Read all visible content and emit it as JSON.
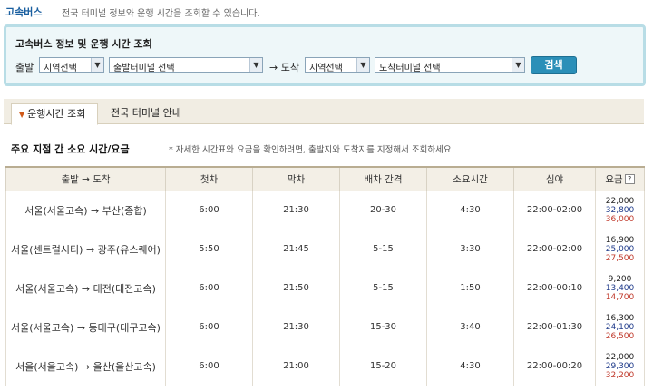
{
  "header": {
    "title": "고속버스",
    "description": "전국 터미널 정보와 운행 시간을 조회할 수 있습니다."
  },
  "search": {
    "title": "고속버스 정보 및 운행 시간 조회",
    "depart_label": "출발",
    "depart_region": "지역선택",
    "depart_terminal": "출발터미널 선택",
    "arrive_label": "→ 도착",
    "arrive_region": "지역선택",
    "arrive_terminal": "도착터미널 선택",
    "search_button": "검색"
  },
  "tabs": [
    {
      "label": "운행시간 조회",
      "active": true
    },
    {
      "label": "전국 터미널 안내",
      "active": false
    }
  ],
  "section": {
    "title": "주요 지점 간 소요 시간/요금",
    "note": "* 자세한 시간표와 요금을 확인하려면, 출발지와 도착지를 지정해서 조회하세요"
  },
  "table": {
    "headers": [
      "출발 → 도착",
      "첫차",
      "막차",
      "배차 간격",
      "소요시간",
      "심야",
      "요금"
    ],
    "rows": [
      {
        "route": "서울(서울고속) → 부산(종합)",
        "first": "6:00",
        "last": "21:30",
        "interval": "20-30",
        "duration": "4:30",
        "night": "22:00-02:00",
        "fares": [
          "22,000",
          "32,800",
          "36,000"
        ]
      },
      {
        "route": "서울(센트럴시티) → 광주(유스퀘어)",
        "first": "5:50",
        "last": "21:45",
        "interval": "5-15",
        "duration": "3:30",
        "night": "22:00-02:00",
        "fares": [
          "16,900",
          "25,000",
          "27,500"
        ]
      },
      {
        "route": "서울(서울고속) → 대전(대전고속)",
        "first": "6:00",
        "last": "21:50",
        "interval": "5-15",
        "duration": "1:50",
        "night": "22:00-00:10",
        "fares": [
          "9,200",
          "13,400",
          "14,700"
        ]
      },
      {
        "route": "서울(서울고속) → 동대구(대구고속)",
        "first": "6:00",
        "last": "21:30",
        "interval": "15-30",
        "duration": "3:40",
        "night": "22:00-01:30",
        "fares": [
          "16,300",
          "24,100",
          "26,500"
        ]
      },
      {
        "route": "서울(서울고속) → 울산(울산고속)",
        "first": "6:00",
        "last": "21:00",
        "interval": "15-20",
        "duration": "4:30",
        "night": "22:00-00:20",
        "fares": [
          "22,000",
          "29,300",
          "32,200"
        ]
      }
    ]
  },
  "colors": {
    "accent_blue": "#2b8fb8",
    "fare_premium": "#1e3a8a",
    "fare_night": "#c0392b",
    "tab_marker": "#d05a1a"
  },
  "icons": {
    "fare_help": "question-icon",
    "dropdown": "chevron-down-icon",
    "tab_marker": "triangle-down-icon"
  }
}
